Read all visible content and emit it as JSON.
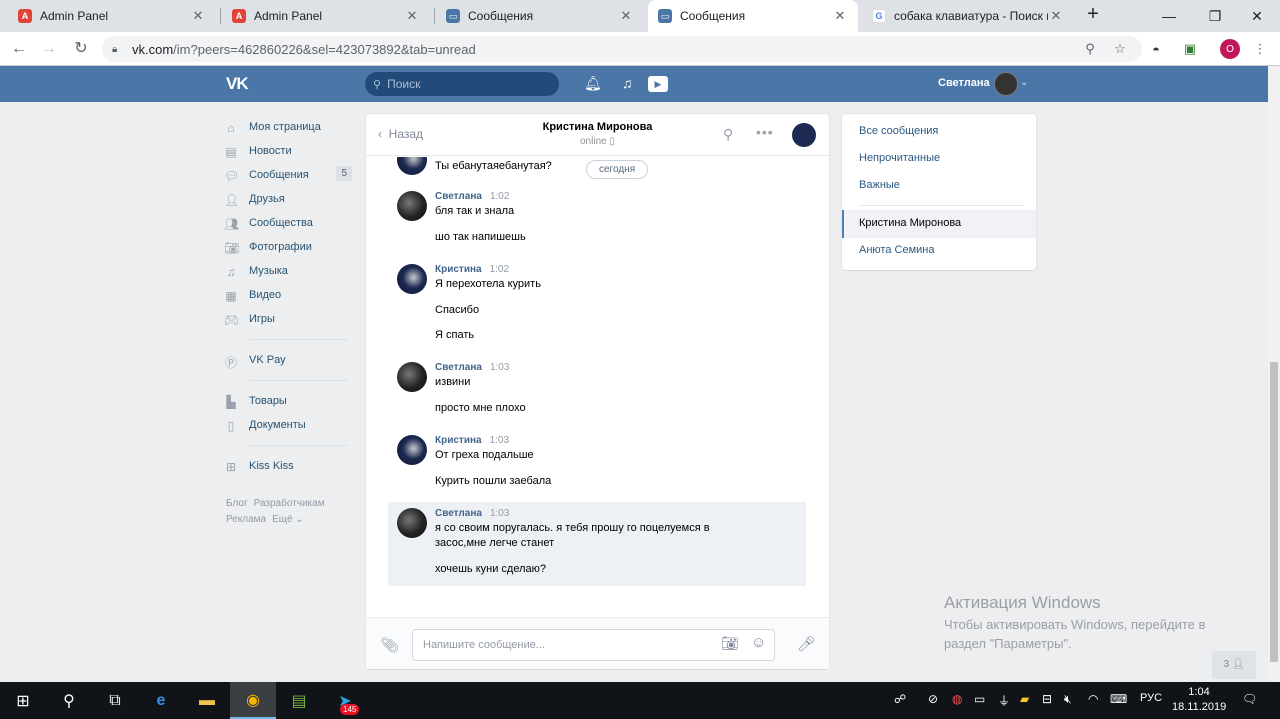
{
  "browser": {
    "tabs": [
      {
        "label": "Admin Panel",
        "favicon": "admin-panel-icon",
        "active": false
      },
      {
        "label": "Admin Panel",
        "favicon": "admin-panel-icon",
        "active": false
      },
      {
        "label": "Сообщения",
        "favicon": "vk-messages-icon",
        "active": false
      },
      {
        "label": "Сообщения",
        "favicon": "vk-messages-icon",
        "active": true
      },
      {
        "label": "собака клавиатура - Поиск в",
        "favicon": "google-icon",
        "active": false
      }
    ],
    "url_host": "vk.com",
    "url_rest": "/im?peers=462860226&sel=423073892&tab=unread",
    "profile_initial": "О"
  },
  "vk": {
    "logo": "VK",
    "search_placeholder": "Поиск",
    "user_name": "Светлана",
    "menu": [
      {
        "label": "Моя страница",
        "icon": "home-icon"
      },
      {
        "label": "Новости",
        "icon": "news-icon"
      },
      {
        "label": "Сообщения",
        "icon": "messages-icon",
        "count": "5"
      },
      {
        "label": "Друзья",
        "icon": "friends-icon"
      },
      {
        "label": "Сообщества",
        "icon": "groups-icon"
      },
      {
        "label": "Фотографии",
        "icon": "camera-icon"
      },
      {
        "label": "Музыка",
        "icon": "music-icon"
      },
      {
        "label": "Видео",
        "icon": "video-icon"
      },
      {
        "label": "Игры",
        "icon": "games-icon"
      },
      {
        "label": "VK Pay",
        "icon": "vkpay-icon"
      },
      {
        "label": "Товары",
        "icon": "bag-icon"
      },
      {
        "label": "Документы",
        "icon": "document-icon"
      },
      {
        "label": "Kiss Kiss",
        "icon": "apps-icon"
      }
    ],
    "footer": {
      "blog": "Блог",
      "dev": "Разработчикам",
      "ads": "Реклама",
      "more": "Ещё ⌄"
    }
  },
  "chat": {
    "back_label": "Назад",
    "title": "Кристина Миронова",
    "status": "online",
    "day_badge": "сегодня",
    "first_line": "Ты ебанутаяебанутая?",
    "groups": [
      {
        "author": "Светлана",
        "time": "1:02",
        "avatar": "dark",
        "lines": [
          "бля так и знала",
          "шо так напишешь"
        ]
      },
      {
        "author": "Кристина",
        "time": "1:02",
        "avatar": "blue",
        "lines": [
          "Я перехотела курить",
          "Спасибо",
          "Я спать"
        ]
      },
      {
        "author": "Светлана",
        "time": "1:03",
        "avatar": "dark",
        "lines": [
          "извини",
          "просто мне плохо"
        ]
      },
      {
        "author": "Кристина",
        "time": "1:03",
        "avatar": "blue",
        "lines": [
          "От греха подальше",
          "Курить пошли заебала"
        ]
      },
      {
        "author": "Светлана",
        "time": "1:03",
        "avatar": "dark",
        "lines": [
          "я со своим поругалась. я тебя прошу го поцелуемся в",
          "засос,мне легче станет",
          "хочешь куни сделаю?"
        ]
      }
    ],
    "composer_placeholder": "Напишите сообщение..."
  },
  "right_panel": {
    "all": "Все сообщения",
    "unread": "Непрочитанные",
    "important": "Важные",
    "active_chat": "Кристина Миронова",
    "other_chat": "Анюта Семина"
  },
  "watermark": {
    "title": "Активация Windows",
    "text": "Чтобы активировать Windows, перейдите в раздел \"Параметры\"."
  },
  "people_count": "3",
  "taskbar": {
    "telegram_badge": "145",
    "lang": "РУС",
    "time": "1:04",
    "date": "18.11.2019"
  }
}
